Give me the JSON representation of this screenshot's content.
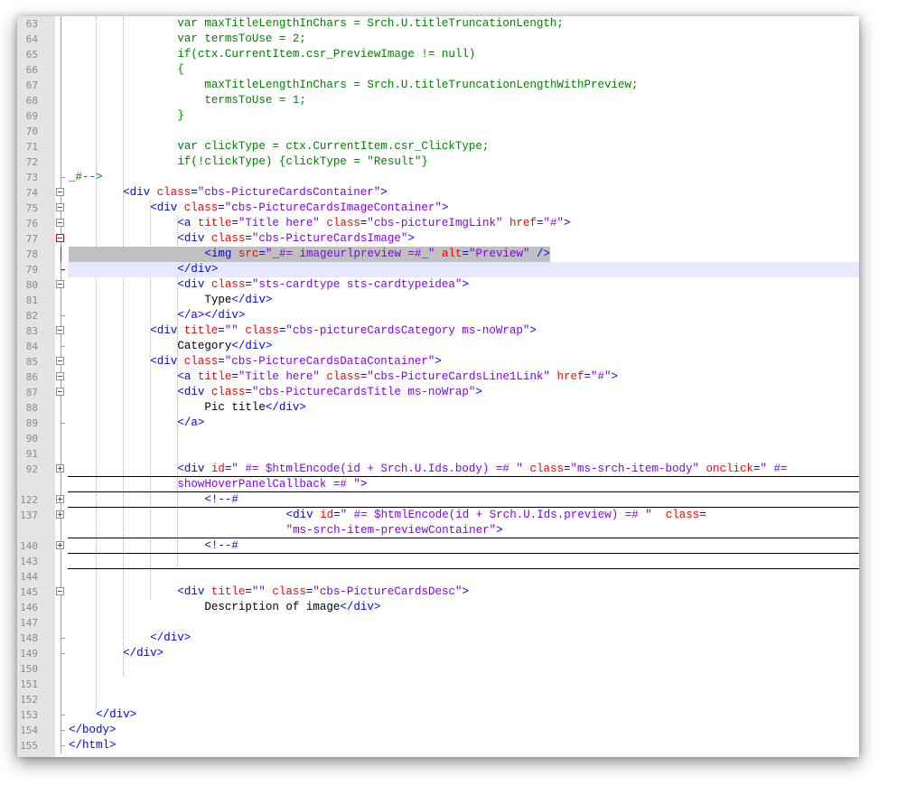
{
  "editor": {
    "colors": {
      "js": "#008000",
      "tag": "#0000ff",
      "attr": "#ff0000",
      "string": "#8000ff",
      "text": "#000000",
      "gutter": "#e4e4e4",
      "caret_line": "#e8e8ff",
      "selection": "#c0c0c0"
    },
    "lines": [
      {
        "n": "63",
        "fold": "",
        "indent": 16,
        "segments": [
          [
            "js",
            "var maxTitleLengthInChars = Srch.U.titleTruncationLength;"
          ]
        ]
      },
      {
        "n": "64",
        "fold": "",
        "indent": 16,
        "segments": [
          [
            "js",
            "var termsToUse = 2;"
          ]
        ]
      },
      {
        "n": "65",
        "fold": "",
        "indent": 16,
        "segments": [
          [
            "js",
            "if(ctx.CurrentItem.csr_PreviewImage != null)"
          ]
        ]
      },
      {
        "n": "66",
        "fold": "",
        "indent": 16,
        "segments": [
          [
            "js",
            "{"
          ]
        ]
      },
      {
        "n": "67",
        "fold": "",
        "indent": 20,
        "segments": [
          [
            "js",
            "maxTitleLengthInChars = Srch.U.titleTruncationLengthWithPreview;"
          ]
        ]
      },
      {
        "n": "68",
        "fold": "",
        "indent": 20,
        "segments": [
          [
            "js",
            "termsToUse = 1;"
          ]
        ]
      },
      {
        "n": "69",
        "fold": "",
        "indent": 16,
        "segments": [
          [
            "js",
            "}"
          ]
        ]
      },
      {
        "n": "70",
        "fold": "",
        "indent": 0,
        "segments": []
      },
      {
        "n": "71",
        "fold": "",
        "indent": 16,
        "segments": [
          [
            "js",
            "var clickType = ctx.CurrentItem.csr_ClickType;"
          ]
        ]
      },
      {
        "n": "72",
        "fold": "",
        "indent": 16,
        "segments": [
          [
            "js",
            "if(!clickType) {clickType = \"Result\"}"
          ]
        ]
      },
      {
        "n": "73",
        "fold": "end",
        "indent": 0,
        "segments": [
          [
            "js",
            "_#-->"
          ]
        ]
      },
      {
        "n": "74",
        "fold": "minus",
        "indent": 8,
        "segments": [
          [
            "tag",
            "<div "
          ],
          [
            "attr",
            "class"
          ],
          [
            "tag",
            "="
          ],
          [
            "str",
            "\"cbs-PictureCardsContainer\""
          ],
          [
            "tag",
            ">"
          ]
        ]
      },
      {
        "n": "75",
        "fold": "minus",
        "indent": 12,
        "segments": [
          [
            "tag",
            "<div "
          ],
          [
            "attr",
            "class"
          ],
          [
            "tag",
            "="
          ],
          [
            "str",
            "\"cbs-PictureCardsImageContainer\""
          ],
          [
            "tag",
            ">"
          ]
        ]
      },
      {
        "n": "76",
        "fold": "minus",
        "indent": 16,
        "segments": [
          [
            "tag",
            "<a "
          ],
          [
            "attr",
            "title"
          ],
          [
            "tag",
            "="
          ],
          [
            "str",
            "\"Title here\""
          ],
          [
            "tag",
            " "
          ],
          [
            "attr",
            "class"
          ],
          [
            "tag",
            "="
          ],
          [
            "str",
            "\"cbs-pictureImgLink\""
          ],
          [
            "tag",
            " "
          ],
          [
            "attr",
            "href"
          ],
          [
            "tag",
            "="
          ],
          [
            "str",
            "\"#\""
          ],
          [
            "tag",
            ">"
          ]
        ]
      },
      {
        "n": "77",
        "fold": "minus-red",
        "indent": 16,
        "segments": [
          [
            "tag",
            "<div "
          ],
          [
            "attr",
            "class"
          ],
          [
            "tag",
            "="
          ],
          [
            "str",
            "\"cbs-PictureCardsImage\""
          ],
          [
            "tag",
            ">"
          ]
        ]
      },
      {
        "n": "78",
        "fold": "red",
        "indent": 20,
        "sel": true,
        "segments": [
          [
            "tag",
            "<img "
          ],
          [
            "attr",
            "src"
          ],
          [
            "tag",
            "="
          ],
          [
            "str",
            "\"_#= imageurlpreview =#_\""
          ],
          [
            "tag",
            " "
          ],
          [
            "attr",
            "alt"
          ],
          [
            "tag",
            "="
          ],
          [
            "str",
            "\"Preview\""
          ],
          [
            "tag",
            " />"
          ]
        ]
      },
      {
        "n": "79",
        "fold": "end-red",
        "indent": 16,
        "caret": true,
        "segments": [
          [
            "tag",
            "</div>"
          ]
        ]
      },
      {
        "n": "80",
        "fold": "minus",
        "indent": 16,
        "segments": [
          [
            "tag",
            "<div "
          ],
          [
            "attr",
            "class"
          ],
          [
            "tag",
            "="
          ],
          [
            "str",
            "\"sts-cardtype sts-cardtypeidea\""
          ],
          [
            "tag",
            ">"
          ]
        ]
      },
      {
        "n": "81",
        "fold": "",
        "indent": 20,
        "segments": [
          [
            "txt",
            "Type"
          ],
          [
            "tag",
            "</div>"
          ]
        ]
      },
      {
        "n": "82",
        "fold": "end",
        "indent": 16,
        "segments": [
          [
            "tag",
            "</a></div>"
          ]
        ]
      },
      {
        "n": "83",
        "fold": "minus",
        "indent": 12,
        "segments": [
          [
            "tag",
            "<div "
          ],
          [
            "attr",
            "title"
          ],
          [
            "tag",
            "="
          ],
          [
            "str",
            "\"\""
          ],
          [
            "tag",
            " "
          ],
          [
            "attr",
            "class"
          ],
          [
            "tag",
            "="
          ],
          [
            "str",
            "\"cbs-pictureCardsCategory ms-noWrap\""
          ],
          [
            "tag",
            ">"
          ]
        ]
      },
      {
        "n": "84",
        "fold": "end",
        "indent": 16,
        "segments": [
          [
            "txt",
            "Category"
          ],
          [
            "tag",
            "</div>"
          ]
        ]
      },
      {
        "n": "85",
        "fold": "minus",
        "indent": 12,
        "segments": [
          [
            "tag",
            "<div "
          ],
          [
            "attr",
            "class"
          ],
          [
            "tag",
            "="
          ],
          [
            "str",
            "\"cbs-PictureCardsDataContainer\""
          ],
          [
            "tag",
            ">"
          ]
        ]
      },
      {
        "n": "86",
        "fold": "minus",
        "indent": 16,
        "segments": [
          [
            "tag",
            "<a "
          ],
          [
            "attr",
            "title"
          ],
          [
            "tag",
            "="
          ],
          [
            "str",
            "\"Title here\""
          ],
          [
            "tag",
            " "
          ],
          [
            "attr",
            "class"
          ],
          [
            "tag",
            "="
          ],
          [
            "str",
            "\"cbs-PictureCardsLine1Link\""
          ],
          [
            "tag",
            " "
          ],
          [
            "attr",
            "href"
          ],
          [
            "tag",
            "="
          ],
          [
            "str",
            "\"#\""
          ],
          [
            "tag",
            ">"
          ]
        ]
      },
      {
        "n": "87",
        "fold": "minus",
        "indent": 16,
        "segments": [
          [
            "tag",
            "<div "
          ],
          [
            "attr",
            "class"
          ],
          [
            "tag",
            "="
          ],
          [
            "str",
            "\"cbs-PictureCardsTitle ms-noWrap\""
          ],
          [
            "tag",
            ">"
          ]
        ]
      },
      {
        "n": "88",
        "fold": "",
        "indent": 20,
        "segments": [
          [
            "txt",
            "Pic title"
          ],
          [
            "tag",
            "</div>"
          ]
        ]
      },
      {
        "n": "89",
        "fold": "end",
        "indent": 16,
        "segments": [
          [
            "tag",
            "</a>"
          ]
        ]
      },
      {
        "n": "90",
        "fold": "",
        "indent": 0,
        "segments": []
      },
      {
        "n": "91",
        "fold": "",
        "indent": 0,
        "segments": []
      },
      {
        "n": "92",
        "fold": "plus",
        "indent": 16,
        "segments": [
          [
            "tag",
            "<div "
          ],
          [
            "attr",
            "id"
          ],
          [
            "tag",
            "="
          ],
          [
            "str",
            "\" #= $htmlEncode(id + Srch.U.Ids.body) =# \""
          ],
          [
            "tag",
            " "
          ],
          [
            "attr",
            "class"
          ],
          [
            "tag",
            "="
          ],
          [
            "str",
            "\"ms-srch-item-body\""
          ],
          [
            "tag",
            " "
          ],
          [
            "attr",
            "onclick"
          ],
          [
            "tag",
            "="
          ],
          [
            "str",
            "\" #="
          ]
        ]
      },
      {
        "n": "",
        "fold": "",
        "indent": 16,
        "segments": [
          [
            "str",
            "showHoverPanelCallback =# \""
          ],
          [
            "tag",
            ">"
          ]
        ]
      },
      {
        "n": "122",
        "fold": "plus",
        "indent": 20,
        "segments": [
          [
            "tag",
            "<!--#"
          ]
        ]
      },
      {
        "n": "137",
        "fold": "plus",
        "indent": 32,
        "segments": [
          [
            "tag",
            "<div "
          ],
          [
            "attr",
            "id"
          ],
          [
            "tag",
            "="
          ],
          [
            "str",
            "\" #= $htmlEncode(id + Srch.U.Ids.preview) =# \""
          ],
          [
            "tag",
            "  "
          ],
          [
            "attr",
            "class"
          ],
          [
            "tag",
            "="
          ]
        ]
      },
      {
        "n": "",
        "fold": "",
        "indent": 32,
        "segments": [
          [
            "str",
            "\"ms-srch-item-previewContainer\""
          ],
          [
            "tag",
            ">"
          ]
        ]
      },
      {
        "n": "140",
        "fold": "plus",
        "indent": 20,
        "segments": [
          [
            "tag",
            "<!--#"
          ]
        ]
      },
      {
        "n": "143",
        "fold": "",
        "indent": 0,
        "segments": []
      },
      {
        "n": "144",
        "fold": "",
        "indent": 0,
        "segments": []
      },
      {
        "n": "145",
        "fold": "minus",
        "indent": 16,
        "segments": [
          [
            "tag",
            "<div "
          ],
          [
            "attr",
            "title"
          ],
          [
            "tag",
            "="
          ],
          [
            "str",
            "\"\""
          ],
          [
            "tag",
            " "
          ],
          [
            "attr",
            "class"
          ],
          [
            "tag",
            "="
          ],
          [
            "str",
            "\"cbs-PictureCardsDesc\""
          ],
          [
            "tag",
            ">"
          ]
        ]
      },
      {
        "n": "146",
        "fold": "",
        "indent": 20,
        "segments": [
          [
            "txt",
            "Description of image"
          ],
          [
            "tag",
            "</div>"
          ]
        ]
      },
      {
        "n": "147",
        "fold": "",
        "indent": 0,
        "segments": []
      },
      {
        "n": "148",
        "fold": "end",
        "indent": 12,
        "segments": [
          [
            "tag",
            "</div>"
          ]
        ]
      },
      {
        "n": "149",
        "fold": "end",
        "indent": 8,
        "segments": [
          [
            "tag",
            "</div>"
          ]
        ]
      },
      {
        "n": "150",
        "fold": "",
        "indent": 0,
        "segments": []
      },
      {
        "n": "151",
        "fold": "",
        "indent": 0,
        "segments": []
      },
      {
        "n": "152",
        "fold": "",
        "indent": 0,
        "segments": []
      },
      {
        "n": "153",
        "fold": "end",
        "indent": 4,
        "segments": [
          [
            "tag",
            "</div>"
          ]
        ]
      },
      {
        "n": "154",
        "fold": "end",
        "indent": 0,
        "segments": [
          [
            "tag",
            "</body>"
          ]
        ]
      },
      {
        "n": "155",
        "fold": "end",
        "indent": 0,
        "segments": [
          [
            "tag",
            "</html>"
          ]
        ]
      }
    ]
  }
}
